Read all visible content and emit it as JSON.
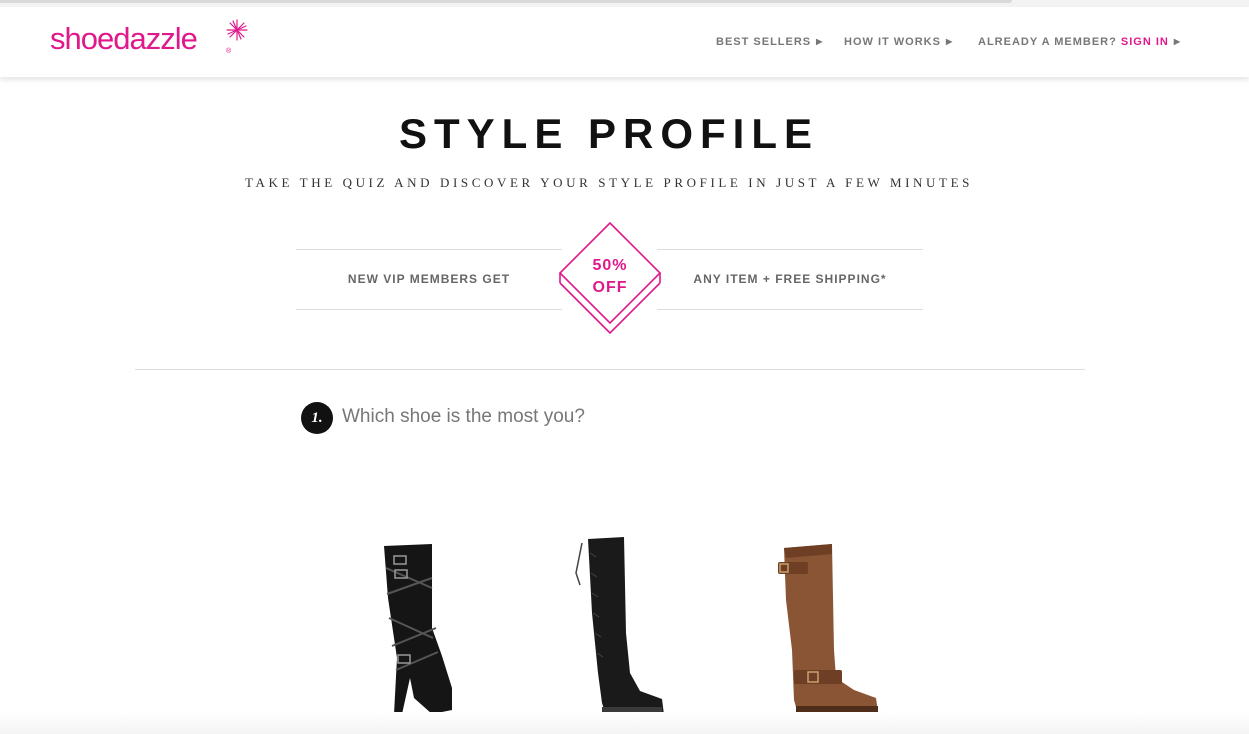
{
  "brand": {
    "logo_text": "shoedazzle",
    "accent_color": "#e0188c"
  },
  "nav": {
    "best_sellers": "BEST SELLERS",
    "how_it_works": "HOW IT WORKS",
    "already_member": "ALREADY A MEMBER?",
    "sign_in": "SIGN IN",
    "arrow_icon": "triangle-right-icon"
  },
  "hero": {
    "title": "STYLE PROFILE",
    "subtitle": "TAKE THE QUIZ AND DISCOVER YOUR STYLE PROFILE IN JUST A FEW MINUTES"
  },
  "promo": {
    "left_text": "NEW VIP MEMBERS GET",
    "discount_line1": "50%",
    "discount_line2": "OFF",
    "right_text": "ANY ITEM + FREE SHIPPING*"
  },
  "quiz": {
    "question_number": "1.",
    "question_text": "Which shoe is the most you?",
    "options": [
      {
        "name": "black strappy buckle heeled boot",
        "color": "#151515"
      },
      {
        "name": "black over-the-knee lace-back boot",
        "color": "#1a1a1a"
      },
      {
        "name": "brown riding boot with buckles",
        "color": "#8a5535"
      }
    ]
  }
}
